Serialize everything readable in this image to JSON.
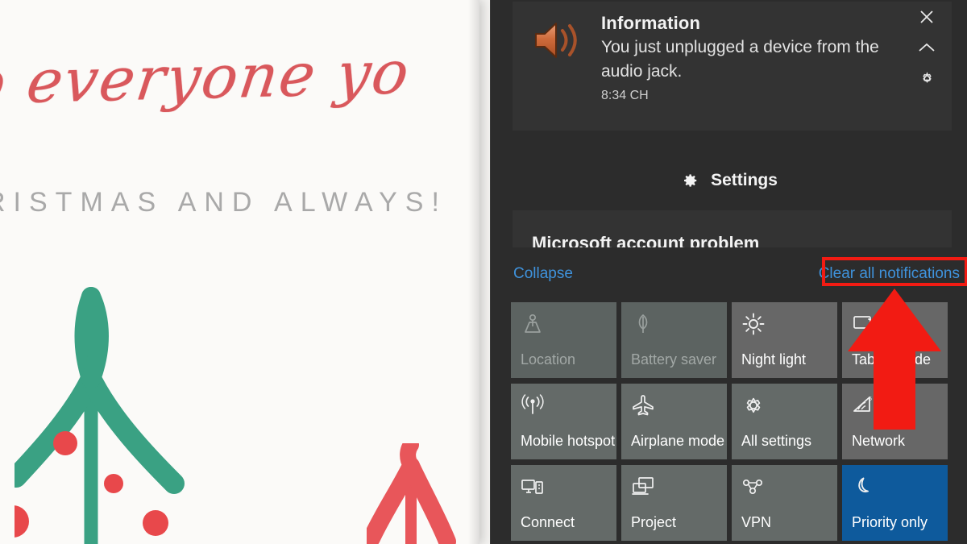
{
  "wallpaper": {
    "script_text": "o everyone yo",
    "caps_text": "RISTMAS AND ALWAYS!",
    "tree_green_color": "#3aa183",
    "tree_red_color": "#e8565a",
    "ornament_color": "#e8484b",
    "card_background": "#fbfaf8"
  },
  "action_center": {
    "panel_background": "#2c2c2c",
    "accent_color": "#0e5a9c",
    "link_color": "#3f93dd",
    "highlight_color": "#f21b13",
    "toast": {
      "icon": "speaker-volume-icon",
      "title": "Information",
      "body": "You just unplugged a device from the audio jack.",
      "time": "8:34 CH",
      "close_icon": "close-icon",
      "collapse_icon": "chevron-up-icon",
      "settings_icon": "gear-icon"
    },
    "settings": {
      "icon": "gear-icon",
      "label": "Settings"
    },
    "clipped_notification": {
      "title": "Microsoft account problem"
    },
    "links": {
      "collapse": "Collapse",
      "clear_all": "Clear all notifications"
    },
    "tiles": [
      {
        "label": "Location",
        "icon": "location-person-icon",
        "state": "dim"
      },
      {
        "label": "Battery saver",
        "icon": "leaf-icon",
        "state": "dim"
      },
      {
        "label": "Night light",
        "icon": "sun-icon",
        "state": "bright"
      },
      {
        "label": "Tablet mode",
        "icon": "tablet-icon",
        "state": "bright"
      },
      {
        "label": "Mobile hotspot",
        "icon": "hotspot-icon",
        "state": "normal"
      },
      {
        "label": "Airplane mode",
        "icon": "airplane-icon",
        "state": "normal"
      },
      {
        "label": "All settings",
        "icon": "gear-icon",
        "state": "normal"
      },
      {
        "label": "Network",
        "icon": "wifi-icon",
        "state": "bright"
      },
      {
        "label": "Connect",
        "icon": "connect-display-icon",
        "state": "normal"
      },
      {
        "label": "Project",
        "icon": "project-screens-icon",
        "state": "normal"
      },
      {
        "label": "VPN",
        "icon": "vpn-icon",
        "state": "normal"
      },
      {
        "label": "Priority only",
        "icon": "moon-icon",
        "state": "accent"
      }
    ]
  },
  "annotation": {
    "arrow": "up-arrow-pointer",
    "arrow_color": "#f21b13"
  }
}
